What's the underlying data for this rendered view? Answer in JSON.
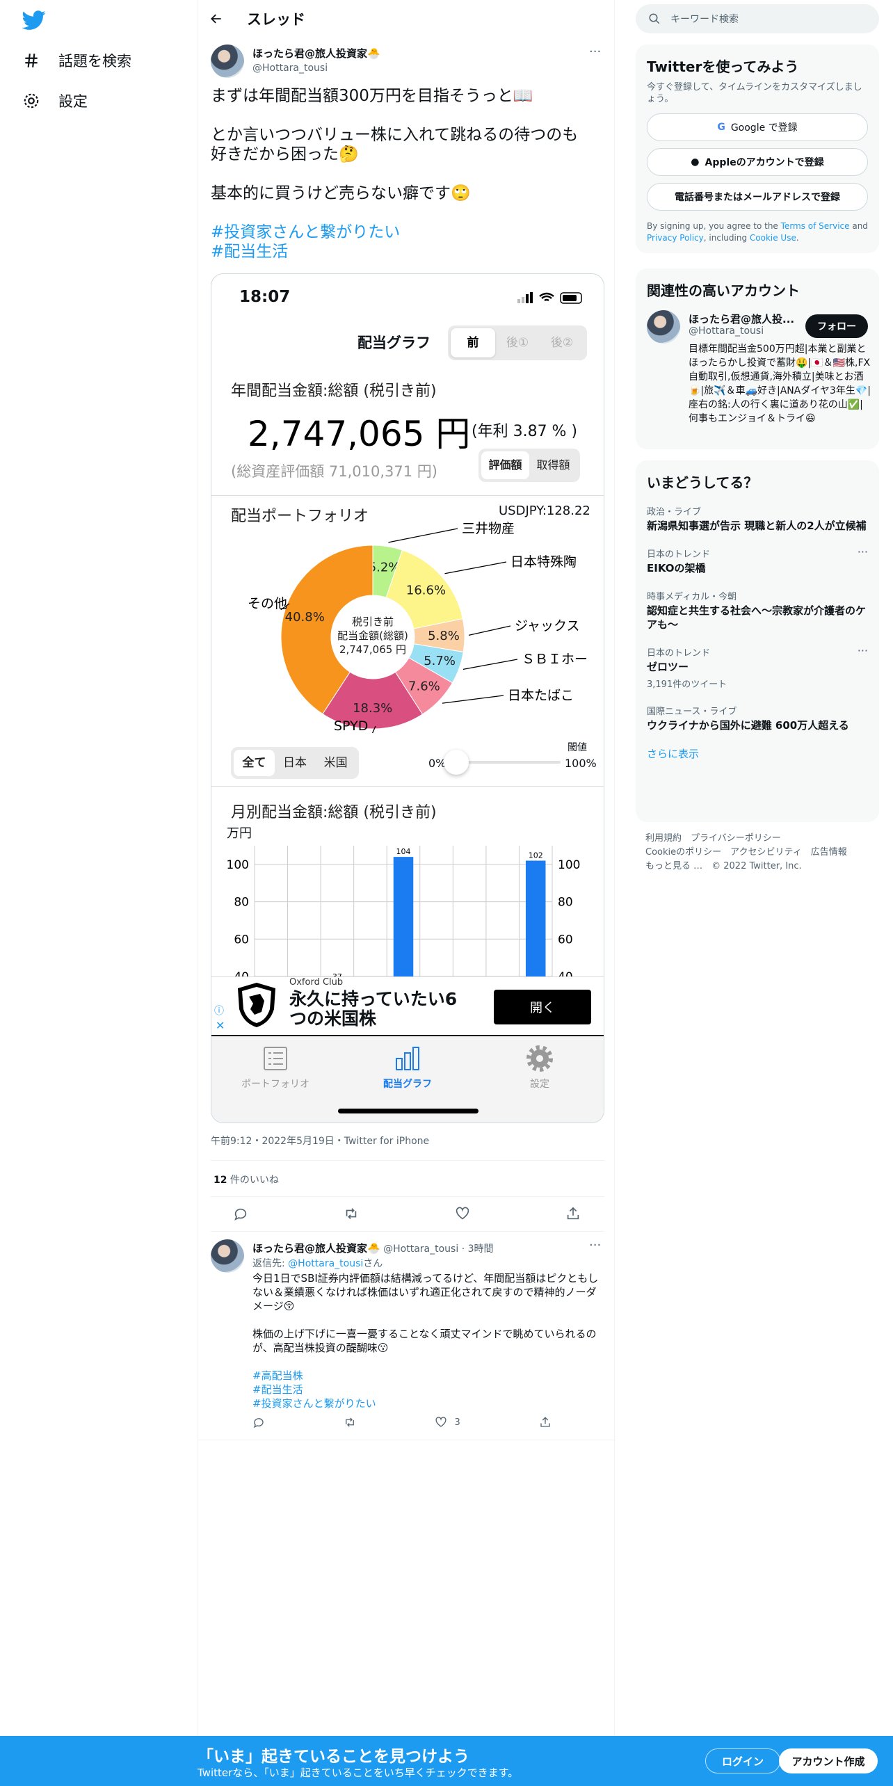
{
  "nav": {
    "explore": "話題を検索",
    "settings": "設定"
  },
  "thread": {
    "title": "スレッド"
  },
  "tweet": {
    "name": "ほったら君@旅人投資家🐣",
    "handle": "@Hottara_tousi",
    "text1": "まずは年間配当額300万円を目指そうっと📖",
    "text2a": "とか言いつつバリュー株に入れて跳ねるの待つのも",
    "text2b": "好きだから困った🤔",
    "text3": "基本的に買うけど売らない癖です🙄",
    "tag1": "#投資家さんと繋がりたい",
    "tag2": "#配当生活",
    "meta": "午前9:12・2022年5月19日・Twitter for iPhone",
    "likes_count": "12",
    "likes_label": " 件のいいね"
  },
  "phone": {
    "time": "18:07",
    "title": "配当グラフ",
    "seg": [
      "前",
      "後①",
      "後②"
    ],
    "annual_label": "年間配当金額:総額 (税引き前)",
    "annual_value": "2,747,065 円",
    "yield": "(年利 3.87 % )",
    "total": "(総資産評価額 71,010,371 円)",
    "seg2": [
      "評価額",
      "取得額"
    ],
    "portfolio_label": "配当ポートフォリオ",
    "usdjpy": "USDJPY:128.22",
    "center1": "税引き前",
    "center2": "配当金額(総額)",
    "center3": "2,747,065 円",
    "filter": [
      "全て",
      "日本",
      "米国"
    ],
    "threshold_label": "閾値",
    "threshold_min": "0%",
    "threshold_max": "100%",
    "threshold_value": 0.0,
    "monthly_label": "月別配当金額:総額 (税引き前)",
    "monthly_unit": "万円",
    "ad_brand": "Oxford Club",
    "ad_text1": "永久に持っていたい6",
    "ad_text2": "つの米国株",
    "ad_open": "開く",
    "tabs": [
      "ポートフォリオ",
      "配当グラフ",
      "設定"
    ]
  },
  "pie_colors": [
    "#f7c8a0",
    "#fbd0b4",
    "#9ae0f5",
    "#f58a9c",
    "#d94f7f",
    "#f7941d",
    "#b8f28a",
    "#fdf48a"
  ],
  "chart_data": [
    {
      "type": "pie",
      "title": "配当ポートフォリオ",
      "slices": [
        {
          "label": "三井物産",
          "value": 5.2
        },
        {
          "label": "日本特殊陶",
          "value": 16.6
        },
        {
          "label": "ジャックス",
          "value": 5.8
        },
        {
          "label": "ＳＢＩホー",
          "value": 5.7
        },
        {
          "label": "日本たばこ",
          "value": 7.6
        },
        {
          "label": "SPYD",
          "value": 18.3
        },
        {
          "label": "その他",
          "value": 40.8
        }
      ]
    },
    {
      "type": "bar",
      "title": "月別配当金額:総額 (税引き前)",
      "ylabel": "万円",
      "values": [
        null,
        null,
        37,
        null,
        104,
        null,
        null,
        null,
        102
      ],
      "yticks": [
        40,
        60,
        80,
        100
      ],
      "ylim": [
        40,
        110
      ]
    }
  ],
  "reply": {
    "name": "ほったら君@旅人投資家🐣",
    "handle": "@Hottara_tousi",
    "time": "3時間",
    "reply_to_label": "返信先: ",
    "reply_to": "@Hottara_tousi",
    "reply_to_suffix": "さん",
    "p1": "今日1日でSBI証券内評価額は結構減ってるけど、年間配当額はピクともしない＆業績悪くなければ株価はいずれ適正化されて戻すので精神的ノーダメージ😚",
    "p2": "株価の上げ下げに一喜一憂することなく頑丈マインドで眺めていられるのが、高配当株投資の醍醐味😗",
    "tag1": "#高配当株",
    "tag2": "#配当生活",
    "tag3": "#投資家さんと繋がりたい",
    "likes": "3"
  },
  "right": {
    "search_placeholder": "キーワード検索",
    "try_title": "Twitterを使ってみよう",
    "try_sub": "今すぐ登録して、タイムラインをカスタマイズしましょう。",
    "google": "Google で登録",
    "apple": "Appleのアカウントで登録",
    "phone": "電話番号またはメールアドレスで登録",
    "terms1": "By signing up, you agree to the ",
    "terms_link": "Terms of Service",
    "terms2": " and ",
    "privacy_link": "Privacy Policy",
    "terms3": ", including ",
    "cookie_link": "Cookie Use",
    "terms4": ".",
    "related_title": "関連性の高いアカウント",
    "acc_name": "ほったら君@旅人投...",
    "acc_handle": "@Hottara_tousi",
    "follow": "フォロー",
    "acc_bio": "目標年間配当金500万円超|本業と副業とほったらかし投資で蓄財🤑|🇯🇵＆🇺🇸株,FX自動取引,仮想通貨,海外積立|美味とお酒🍺|旅✈️＆車🚙好き|ANAダイヤ3年生💎|座右の銘:人の行く裏に道あり花の山✅|何事もエンジョイ＆トライ😆",
    "trends_title": "いまどうしてる？",
    "trends": [
      {
        "cat": "政治・ライブ",
        "title": "新潟県知事選が告示 現職と新人の2人が立候補"
      },
      {
        "cat": "日本のトレンド",
        "title": "EIKOの架橋"
      },
      {
        "cat": "時事メディカル・今朝",
        "title": "認知症と共生する社会へ～宗教家が介護者のケアも～"
      },
      {
        "cat": "日本のトレンド",
        "title": "ゼロツー",
        "count": "3,191件のツイート"
      },
      {
        "cat": "国際ニュース・ライブ",
        "title": "ウクライナから国外に避難 600万人超える"
      }
    ],
    "show_more": "さらに表示",
    "footer1": "利用規約　プライバシーポリシー",
    "footer2": "Cookieのポリシー　アクセシビリティ　広告情報",
    "footer3": "もっと見る …　© 2022 Twitter, Inc."
  },
  "bottom": {
    "title": "「いま」起きていることを見つけよう",
    "sub": "Twitterなら、「いま」起きていることをいち早くチェックできます。",
    "login": "ログイン",
    "signup": "アカウント作成"
  }
}
